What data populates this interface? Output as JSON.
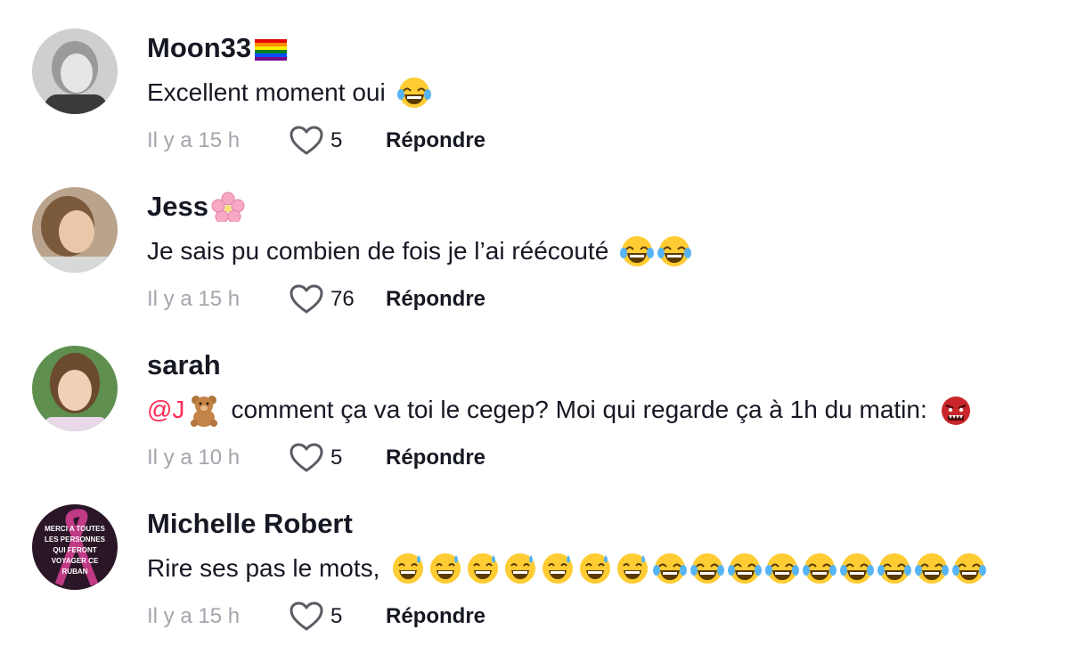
{
  "comments": [
    {
      "username": "Moon33",
      "badge": "rainbow-flag-emoji",
      "text": "Excellent moment oui",
      "emojis": [
        "laughing-tears-emoji"
      ],
      "time": "Il y a 15 h",
      "likes": "5",
      "reply_label": "Répondre"
    },
    {
      "username": "Jess",
      "badge": "cherry-blossom-emoji",
      "text": "Je sais pu combien de fois je l’ai réécouté",
      "emojis": [
        "laughing-tears-emoji",
        "laughing-tears-emoji"
      ],
      "time": "Il y a 15 h",
      "likes": "76",
      "reply_label": "Répondre"
    },
    {
      "username": "sarah",
      "mention": "@J",
      "mention_emoji": "teddy-bear-emoji",
      "text": "comment ça va toi le cegep? Moi qui regarde ça à 1h du matin:",
      "emojis": [
        "ogre-emoji"
      ],
      "time": "Il y a 10 h",
      "likes": "5",
      "reply_label": "Répondre"
    },
    {
      "username": "Michelle Robert",
      "avatar_text": "MERCI A TOUTES LES PERSONNES QUI FERONT VOYAGER CE RUBAN",
      "text": "Rire ses pas le mots,",
      "emojis": [
        "sweat-smile-emoji",
        "sweat-smile-emoji",
        "sweat-smile-emoji",
        "sweat-smile-emoji",
        "sweat-smile-emoji",
        "sweat-smile-emoji",
        "sweat-smile-emoji",
        "laughing-tears-emoji",
        "laughing-tears-emoji",
        "laughing-tears-emoji",
        "laughing-tears-emoji",
        "laughing-tears-emoji",
        "laughing-tears-emoji",
        "laughing-tears-emoji",
        "laughing-tears-emoji",
        "laughing-tears-emoji"
      ],
      "time": "Il y a 15 h",
      "likes": "5",
      "reply_label": "Répondre"
    }
  ],
  "colors": {
    "text": "#161823",
    "muted": "#a3a5ad",
    "mention": "#fe2c55"
  }
}
